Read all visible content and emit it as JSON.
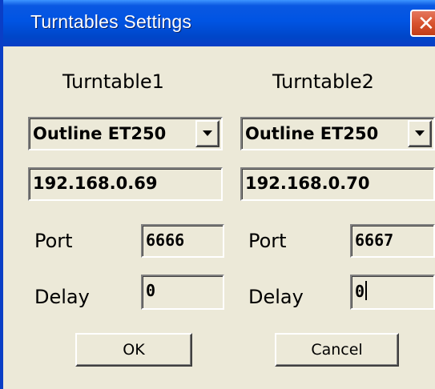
{
  "window": {
    "title": "Turntables Settings",
    "close_symbol": "✕"
  },
  "turntable1": {
    "heading": "Turntable1",
    "model": "Outline ET250",
    "ip": "192.168.0.69",
    "port_label": "Port",
    "port": "6666",
    "delay_label": "Delay",
    "delay": "0"
  },
  "turntable2": {
    "heading": "Turntable2",
    "model": "Outline ET250",
    "ip": "192.168.0.70",
    "port_label": "Port",
    "port": "6667",
    "delay_label": "Delay",
    "delay": "0"
  },
  "buttons": {
    "ok": "OK",
    "cancel": "Cancel"
  },
  "colors": {
    "titlebar": "#0054e3",
    "face": "#ece9d8",
    "close": "#d8532f"
  }
}
